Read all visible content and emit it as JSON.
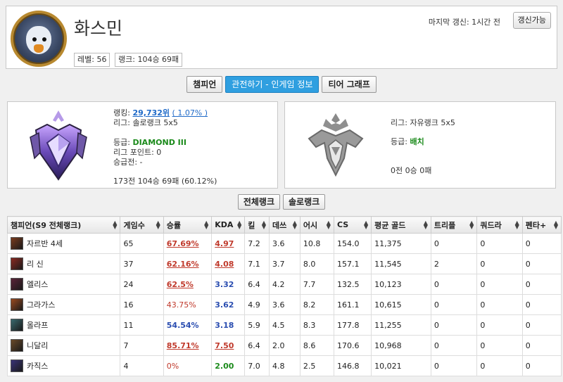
{
  "profile": {
    "name": "화스민",
    "level": "레벨: 56",
    "rank_record": "랭크: 104승 69패",
    "last_update": "마지막 갱신: 1시간 전",
    "refresh_label": "갱신가능"
  },
  "tabs": [
    {
      "label": "챔피언",
      "active": false
    },
    {
      "label": "관전하기 - 인게임 정보",
      "active": true
    },
    {
      "label": "티어 그래프",
      "active": false
    }
  ],
  "solo_rank": {
    "ranking_prefix": "랭킹: ",
    "ranking_value": "29,732위",
    "ranking_pct": "( 1.07% )",
    "league": "리그: 솔로랭크 5x5",
    "tier_prefix": "등급: ",
    "tier_value": "DIAMOND III",
    "league_points": "리그 포인트: 0",
    "promotion": "승급전: -",
    "record": "173전 104승 69패 (60.12%)"
  },
  "flex_rank": {
    "league": "리그: 자유랭크 5x5",
    "tier_prefix": "등급: ",
    "tier_value": "배치",
    "record": "0전 0승 0패"
  },
  "subtabs": [
    "전체랭크",
    "솔로랭크"
  ],
  "table": {
    "headers": [
      "챔피언(S9 전체랭크)",
      "게임수",
      "승률",
      "KDA",
      "킬",
      "데쓰",
      "어시",
      "CS",
      "평균 골드",
      "트리플",
      "쿼드라",
      "펜타+"
    ],
    "rows": [
      {
        "champ": "자르반 4세",
        "icon_color": "#7a3b1e",
        "games": "65",
        "winrate": "67.69%",
        "wr_style": "red-u",
        "kda": "4.97",
        "kda_style": "red-u",
        "kills": "7.2",
        "deaths": "3.6",
        "assists": "10.8",
        "cs": "154.0",
        "gold": "11,375",
        "triple": "0",
        "quadra": "0",
        "penta": "0"
      },
      {
        "champ": "리 신",
        "icon_color": "#8a2a22",
        "games": "37",
        "winrate": "62.16%",
        "wr_style": "red-u",
        "kda": "4.08",
        "kda_style": "red-u",
        "kills": "7.1",
        "deaths": "3.7",
        "assists": "8.0",
        "cs": "157.1",
        "gold": "11,545",
        "triple": "2",
        "quadra": "0",
        "penta": "0"
      },
      {
        "champ": "엘리스",
        "icon_color": "#5a2438",
        "games": "24",
        "winrate": "62.5%",
        "wr_style": "red-u",
        "kda": "3.32",
        "kda_style": "blue",
        "kills": "6.4",
        "deaths": "4.2",
        "assists": "7.7",
        "cs": "132.5",
        "gold": "10,123",
        "triple": "0",
        "quadra": "0",
        "penta": "0"
      },
      {
        "champ": "그라가스",
        "icon_color": "#9a4a20",
        "games": "16",
        "winrate": "43.75%",
        "wr_style": "red",
        "kda": "3.62",
        "kda_style": "blue",
        "kills": "4.9",
        "deaths": "3.6",
        "assists": "8.2",
        "cs": "161.1",
        "gold": "10,615",
        "triple": "0",
        "quadra": "0",
        "penta": "0"
      },
      {
        "champ": "올라프",
        "icon_color": "#3a6a6e",
        "games": "11",
        "winrate": "54.54%",
        "wr_style": "blue",
        "kda": "3.18",
        "kda_style": "blue",
        "kills": "5.9",
        "deaths": "4.5",
        "assists": "8.3",
        "cs": "177.8",
        "gold": "11,255",
        "triple": "0",
        "quadra": "0",
        "penta": "0"
      },
      {
        "champ": "니달리",
        "icon_color": "#6a4a2a",
        "games": "7",
        "winrate": "85.71%",
        "wr_style": "red-u",
        "kda": "7.50",
        "kda_style": "red-u",
        "kills": "6.4",
        "deaths": "2.0",
        "assists": "8.6",
        "cs": "170.6",
        "gold": "10,968",
        "triple": "0",
        "quadra": "0",
        "penta": "0"
      },
      {
        "champ": "카직스",
        "icon_color": "#3a3478",
        "games": "4",
        "winrate": "0%",
        "wr_style": "red",
        "kda": "2.00",
        "kda_style": "green2",
        "kills": "7.0",
        "deaths": "4.8",
        "assists": "2.5",
        "cs": "146.8",
        "gold": "10,021",
        "triple": "0",
        "quadra": "0",
        "penta": "0"
      }
    ]
  }
}
